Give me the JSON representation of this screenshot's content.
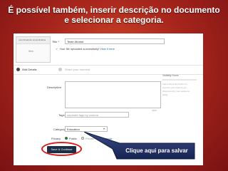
{
  "headline": {
    "line1": "É possível também, inserir descrição no documento",
    "line2": "e selecionar a categoria."
  },
  "upload": {
    "thumb_top_text": "noturninadulto tsnunuilnalina",
    "thumb_mid_text": "Item",
    "title_label": "Title *",
    "title_value": "Teste Abobot",
    "success_text": "Your file uploaded successfully!",
    "success_link": "View it here",
    "step1_label": "Add Details",
    "step2_label": "Share your moment",
    "description_label": "Description",
    "char_count": "3000",
    "tags_label": "Tags",
    "tags_placeholder": "separate tags by comma",
    "category_label": "Category",
    "category_value": "Education",
    "privacy_label": "Privacy",
    "privacy_options": [
      "Public",
      "Private"
    ],
    "learn_more": "Learn more",
    "save_button": "Save & Continue",
    "sidebar_title": "Visibility Score",
    "sidebar_lines": [
      "Add a title & description to",
      "improve your reach & get",
      "discovered by your audience",
      "easily"
    ]
  },
  "callout": {
    "text": "Clique aqui para salvar"
  },
  "colors": {
    "background": "#a8261c",
    "button": "#1c2d48",
    "highlight_ring": "#d91e1e",
    "link": "#2a67b5"
  }
}
